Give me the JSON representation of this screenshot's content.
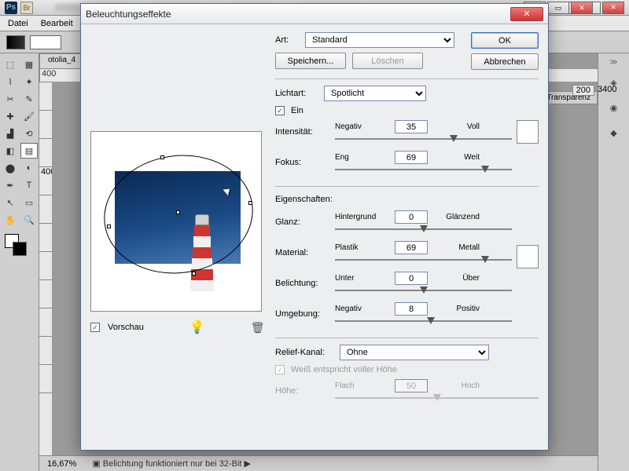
{
  "app": {
    "logo": "Ps",
    "bridge": "Br"
  },
  "menu": {
    "file": "Datei",
    "edit": "Bearbeit"
  },
  "doc": {
    "tab": "otolia_4",
    "zoom": "16,67%",
    "status": "Belichtung funktioniert nur bei 32-Bit"
  },
  "rulers_h": [
    "400"
  ],
  "rulers_v": [
    "400"
  ],
  "ruler_right": [
    "200",
    "3400"
  ],
  "rpanel": {
    "tab": "Transparenz"
  },
  "dialog": {
    "title": "Beleuchtungseffekte",
    "ok": "OK",
    "cancel": "Abbrechen",
    "art_label": "Art:",
    "art_value": "Standard",
    "save": "Speichern...",
    "delete": "Löschen",
    "lichtart_label": "Lichtart:",
    "lichtart_value": "Spotlicht",
    "ein": "Ein",
    "intensitaet": {
      "label": "Intensität:",
      "left": "Negativ",
      "right": "Voll",
      "value": "35",
      "pct": 67
    },
    "fokus": {
      "label": "Fokus:",
      "left": "Eng",
      "right": "Weit",
      "value": "69",
      "pct": 85
    },
    "eigenschaften": "Eigenschaften:",
    "glanz": {
      "label": "Glanz:",
      "left": "Hintergrund",
      "right": "Glänzend",
      "value": "0",
      "pct": 50
    },
    "material": {
      "label": "Material:",
      "left": "Plastik",
      "right": "Metall",
      "value": "69",
      "pct": 85
    },
    "belichtung": {
      "label": "Belichtung:",
      "left": "Unter",
      "right": "Über",
      "value": "0",
      "pct": 50
    },
    "umgebung": {
      "label": "Umgebung:",
      "left": "Negativ",
      "right": "Positiv",
      "value": "8",
      "pct": 54
    },
    "relief_label": "Relief-Kanal:",
    "relief_value": "Ohne",
    "weiss": "Weiß entspricht voller Höhe",
    "hoehe": {
      "label": "Höhe:",
      "left": "Flach",
      "right": "Hoch",
      "value": "50",
      "pct": 50
    },
    "vorschau": "Vorschau"
  }
}
